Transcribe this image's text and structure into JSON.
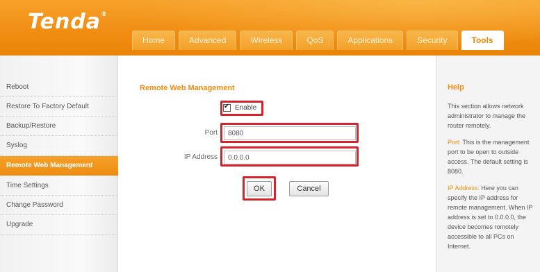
{
  "header": {
    "logo": "Tenda",
    "logo_mark": "®",
    "tabs": [
      {
        "label": "Home"
      },
      {
        "label": "Advanced"
      },
      {
        "label": "Wireless"
      },
      {
        "label": "QoS"
      },
      {
        "label": "Applications"
      },
      {
        "label": "Security"
      },
      {
        "label": "Tools",
        "active": true
      }
    ]
  },
  "sidebar": {
    "items": [
      {
        "label": "Reboot"
      },
      {
        "label": "Restore To Factory Default"
      },
      {
        "label": "Backup/Restore"
      },
      {
        "label": "Syslog"
      },
      {
        "label": "Remote Web Management",
        "active": true
      },
      {
        "label": "Time Settings"
      },
      {
        "label": "Change Password"
      },
      {
        "label": "Upgrade"
      }
    ]
  },
  "main": {
    "title": "Remote Web Management",
    "enable_label": "Enable",
    "enable_checked": true,
    "port_label": "Port",
    "port_value": "8080",
    "ip_label": "IP Address",
    "ip_value": "0.0.0.0",
    "ok_label": "OK",
    "cancel_label": "Cancel"
  },
  "help": {
    "title": "Help",
    "intro": "This section allows network administrator to manage the router remotely.",
    "port_kw": "Port:",
    "port_text": " This is the management port to be open to outside access. The default setting is 8080.",
    "ip_kw": "IP Address:",
    "ip_text": " Here you can specify the IP address for remote management. When IP address is set to 0.0.0.0, the device becomes romotely accessible to all PCs on Internet."
  },
  "colors": {
    "brand_orange": "#f08d12",
    "highlight_red": "#d4232c"
  }
}
